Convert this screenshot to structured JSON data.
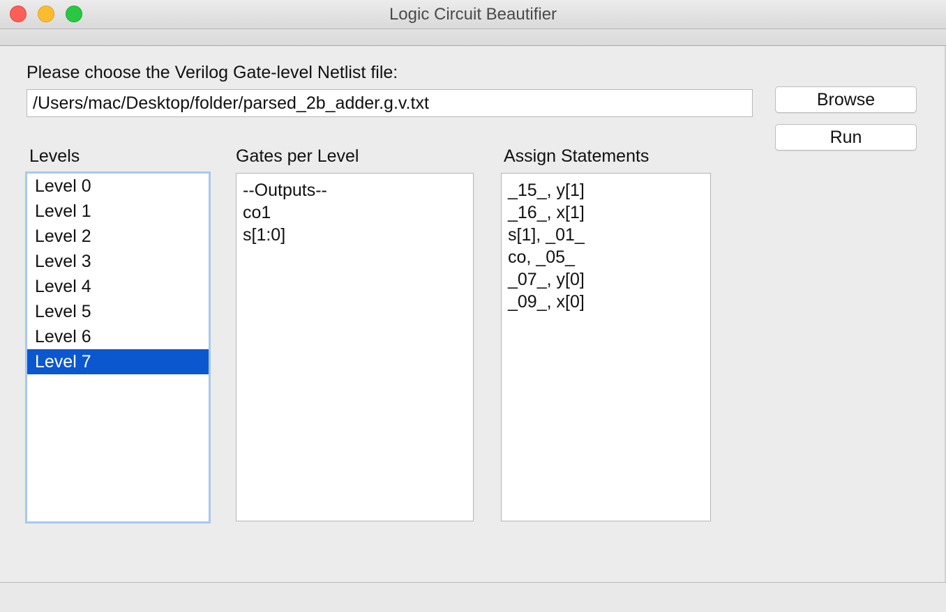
{
  "window": {
    "title": "Logic Circuit Beautifier"
  },
  "file": {
    "prompt": "Please choose the Verilog Gate-level Netlist file:",
    "path": "/Users/mac/Desktop/folder/parsed_2b_adder.g.v.txt"
  },
  "buttons": {
    "browse": "Browse",
    "run": "Run"
  },
  "levels": {
    "label": "Levels",
    "items": [
      "Level 0",
      "Level 1",
      "Level 2",
      "Level 3",
      "Level 4",
      "Level 5",
      "Level 6",
      "Level 7"
    ],
    "selected": "Level 7"
  },
  "gates": {
    "label": "Gates per Level",
    "lines": [
      "--Outputs--",
      "co1",
      "s[1:0]"
    ]
  },
  "assign": {
    "label": "Assign Statements",
    "lines": [
      "_15_, y[1]",
      "_16_, x[1]",
      "s[1], _01_",
      "co, _05_",
      "_07_, y[0]",
      "_09_, x[0]"
    ]
  },
  "colors": {
    "selection": "#0b57d0",
    "focus_ring": "#a8c8ec",
    "close": "#fc5f57",
    "minimize": "#fdbc2e",
    "maximize": "#28c840"
  }
}
